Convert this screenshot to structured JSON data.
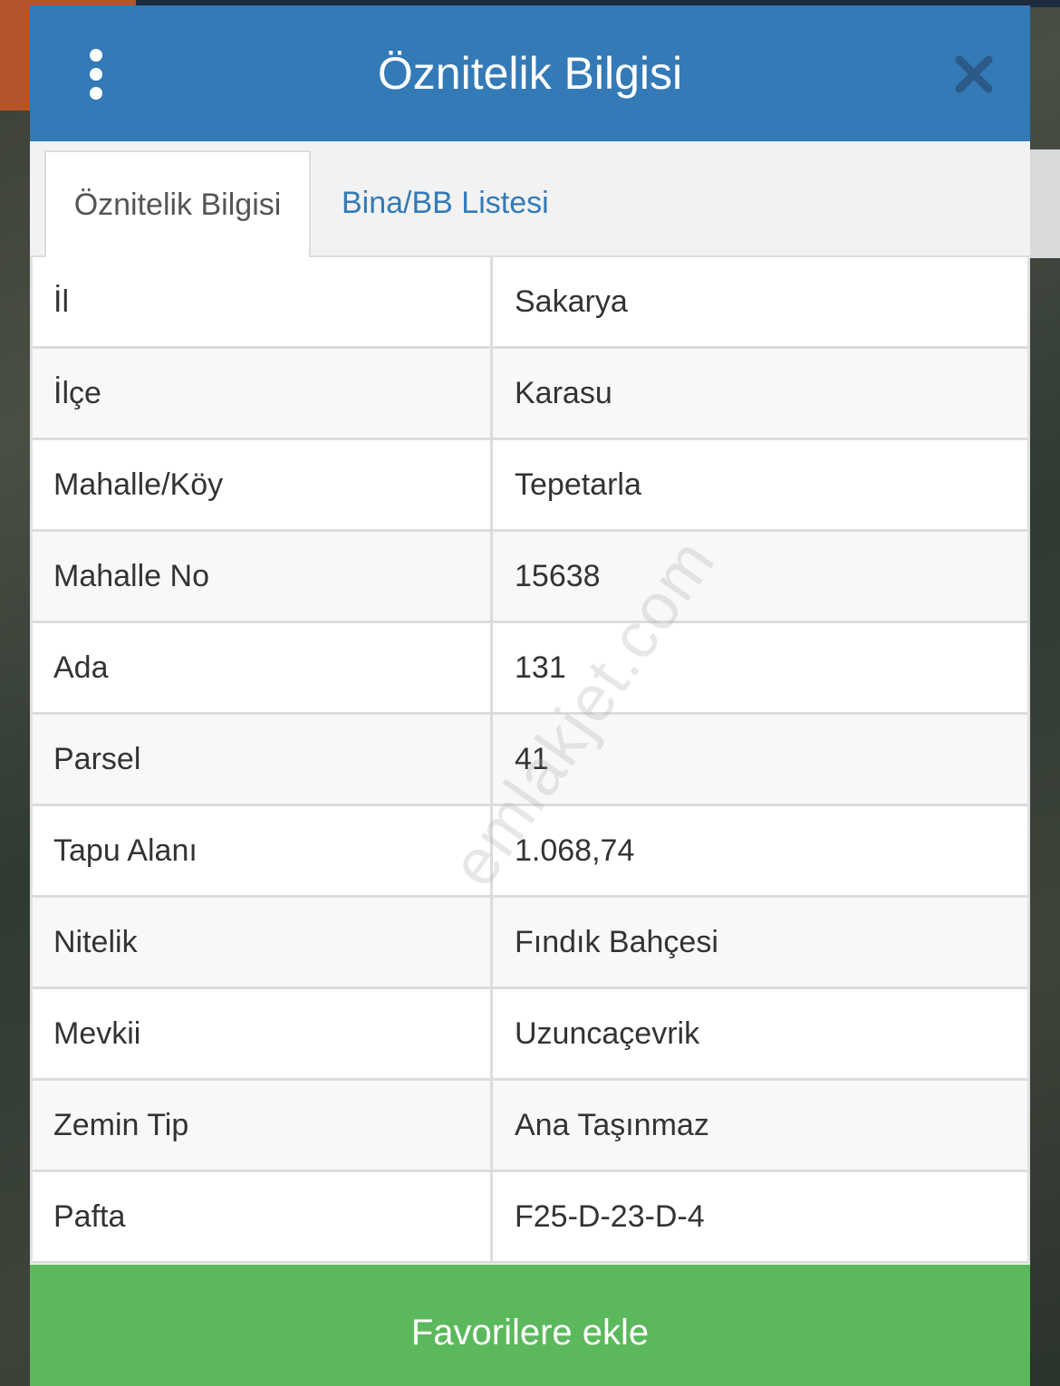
{
  "header": {
    "title": "Öznitelik Bilgisi"
  },
  "tabs": [
    {
      "label": "Öznitelik Bilgisi",
      "active": true
    },
    {
      "label": "Bina/BB Listesi",
      "active": false
    }
  ],
  "rows": [
    {
      "label": "İl",
      "value": "Sakarya"
    },
    {
      "label": "İlçe",
      "value": "Karasu"
    },
    {
      "label": "Mahalle/Köy",
      "value": "Tepetarla"
    },
    {
      "label": "Mahalle No",
      "value": "15638"
    },
    {
      "label": "Ada",
      "value": "131"
    },
    {
      "label": "Parsel",
      "value": "41"
    },
    {
      "label": "Tapu Alanı",
      "value": "1.068,74"
    },
    {
      "label": "Nitelik",
      "value": "Fındık Bahçesi"
    },
    {
      "label": "Mevkii",
      "value": "Uzuncaçevrik"
    },
    {
      "label": "Zemin Tip",
      "value": "Ana Taşınmaz"
    },
    {
      "label": "Pafta",
      "value": "F25-D-23-D-4"
    }
  ],
  "watermark": "emlakjet.com",
  "footer": {
    "favorite_label": "Favorilere ekle"
  },
  "colors": {
    "header": "#337ab7",
    "tab_link": "#337ab7",
    "favorite_button": "#5cb85c"
  },
  "icons": {
    "menu": "vertical-ellipsis-icon",
    "close": "close-icon"
  }
}
